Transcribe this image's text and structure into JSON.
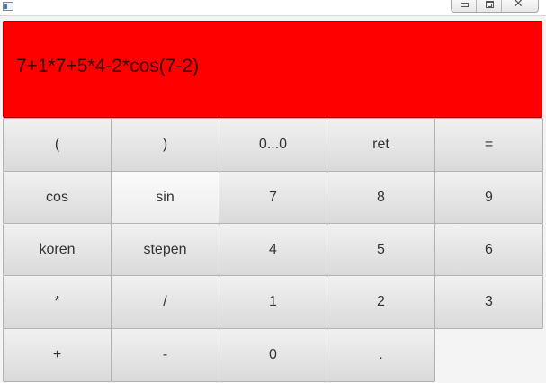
{
  "window": {
    "controls": [
      "minimize",
      "maximize",
      "close"
    ]
  },
  "display": {
    "expression": "7+1*7+5*4-2*cos(7-2)",
    "background": "#ff0000"
  },
  "keys": [
    [
      "(",
      ")",
      "0...0",
      "ret",
      "="
    ],
    [
      "cos",
      "sin",
      "7",
      "8",
      "9"
    ],
    [
      "koren",
      "stepen",
      "4",
      "5",
      "6"
    ],
    [
      "*",
      "/",
      "1",
      "2",
      "3"
    ],
    [
      "+",
      "-",
      "0",
      "."
    ]
  ]
}
